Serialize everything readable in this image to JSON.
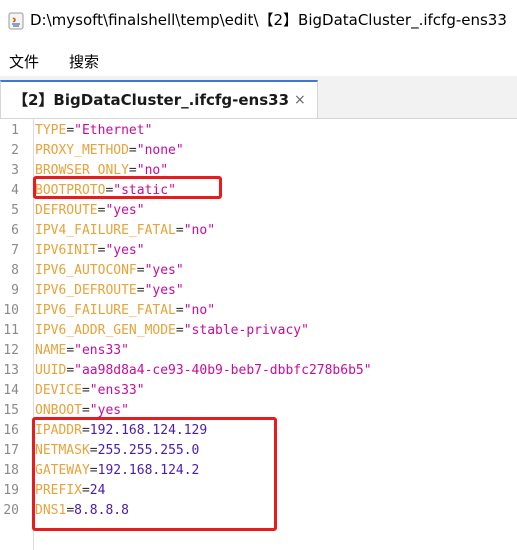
{
  "window": {
    "title": "D:\\mysoft\\finalshell\\temp\\edit\\【2】BigDataCluster_.ifcfg-ens33"
  },
  "menu": {
    "file": "文件",
    "search": "搜索"
  },
  "tab": {
    "label": "【2】BigDataCluster_.ifcfg-ens33",
    "close": "×"
  },
  "lines": [
    {
      "num": "1",
      "key": "TYPE",
      "eq": "=",
      "val": "\"Ethernet\""
    },
    {
      "num": "2",
      "key": "PROXY_METHOD",
      "eq": "=",
      "val": "\"none\""
    },
    {
      "num": "3",
      "key": "BROWSER_ONLY",
      "eq": "=",
      "val": "\"no\""
    },
    {
      "num": "4",
      "key": "BOOTPROTO",
      "eq": "=",
      "val": "\"static\""
    },
    {
      "num": "5",
      "key": "DEFROUTE",
      "eq": "=",
      "val": "\"yes\""
    },
    {
      "num": "6",
      "key": "IPV4_FAILURE_FATAL",
      "eq": "=",
      "val": "\"no\""
    },
    {
      "num": "7",
      "key": "IPV6INIT",
      "eq": "=",
      "val": "\"yes\""
    },
    {
      "num": "8",
      "key": "IPV6_AUTOCONF",
      "eq": "=",
      "val": "\"yes\""
    },
    {
      "num": "9",
      "key": "IPV6_DEFROUTE",
      "eq": "=",
      "val": "\"yes\""
    },
    {
      "num": "10",
      "key": "IPV6_FAILURE_FATAL",
      "eq": "=",
      "val": "\"no\""
    },
    {
      "num": "11",
      "key": "IPV6_ADDR_GEN_MODE",
      "eq": "=",
      "val": "\"stable-privacy\""
    },
    {
      "num": "12",
      "key": "NAME",
      "eq": "=",
      "val": "\"ens33\""
    },
    {
      "num": "13",
      "key": "UUID",
      "eq": "=",
      "val": "\"aa98d8a4-ce93-40b9-beb7-dbbfc278b6b5\""
    },
    {
      "num": "14",
      "key": "DEVICE",
      "eq": "=",
      "val": "\"ens33\""
    },
    {
      "num": "15",
      "key": "ONBOOT",
      "eq": "=",
      "val": "\"yes\""
    },
    {
      "num": "16",
      "key": "IPADDR",
      "eq": "=",
      "val": "192.168.124.129"
    },
    {
      "num": "17",
      "key": "NETMASK",
      "eq": "=",
      "val": "255.255.255.0"
    },
    {
      "num": "18",
      "key": "GATEWAY",
      "eq": "=",
      "val": "192.168.124.2"
    },
    {
      "num": "19",
      "key": "PREFIX",
      "eq": "=",
      "val": "24"
    },
    {
      "num": "20",
      "key": "DNS1",
      "eq": "=",
      "val": "8.8.8.8"
    }
  ],
  "colors": {
    "key": "#e8a33a",
    "string": "#c70c9c",
    "number": "#4a1bb0",
    "highlight": "#e81c1c"
  }
}
